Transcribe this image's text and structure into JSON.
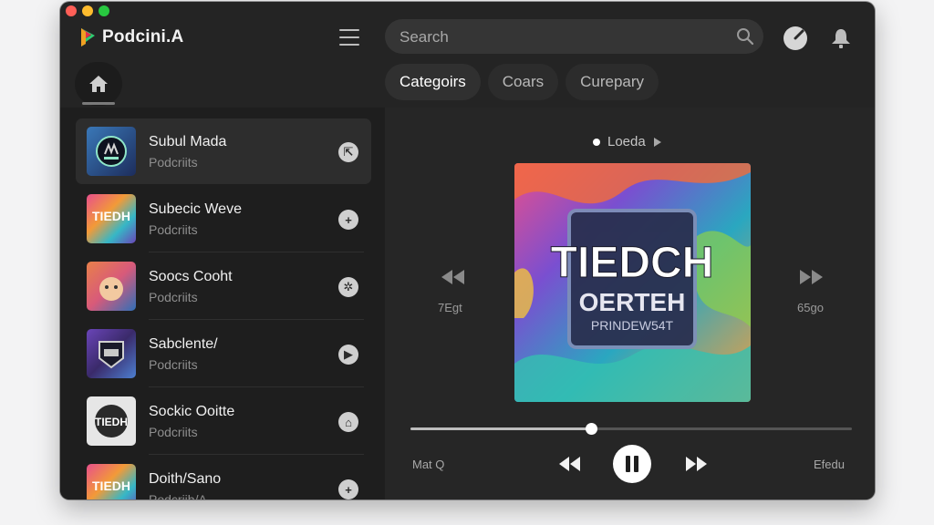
{
  "app": {
    "name": "Podcini.A"
  },
  "colors": {
    "window_bg": "#242424",
    "sidebar_bg": "#1e1e1e",
    "accent_green": "#2ecc71",
    "accent_red": "#e0304a"
  },
  "search": {
    "placeholder": "Search"
  },
  "tabs": [
    {
      "label": "Categoirs",
      "active": true
    },
    {
      "label": "Coars",
      "active": false
    },
    {
      "label": "Curepary",
      "active": false
    }
  ],
  "episodes": [
    {
      "title": "Subul Mada",
      "subtitle": "Podcriits",
      "action_icon": "share-icon",
      "selected": true
    },
    {
      "title": "Subecic Weve",
      "subtitle": "Podcriits",
      "action_icon": "plus-icon",
      "selected": false
    },
    {
      "title": "Soocs Cooht",
      "subtitle": "Podcriits",
      "action_icon": "settings-icon",
      "selected": false
    },
    {
      "title": "Sabclente/",
      "subtitle": "Podcriits",
      "action_icon": "play-icon",
      "selected": false
    },
    {
      "title": "Sockic Ooitte",
      "subtitle": "Podcriits",
      "action_icon": "home-icon",
      "selected": false
    },
    {
      "title": "Doith/Sano",
      "subtitle": "Podcriib/A",
      "action_icon": "plus-icon",
      "selected": false
    }
  ],
  "thumbs": [
    {
      "text": ""
    },
    {
      "text": "TIEDH"
    },
    {
      "text": ""
    },
    {
      "text": ""
    },
    {
      "text": "TIEDH"
    },
    {
      "text": "TIEDH"
    }
  ],
  "now_playing": {
    "status": "Loeda",
    "cover": {
      "line1": "TIEDCH",
      "line2": "OERTEH",
      "line3": "PRINDEW54T"
    },
    "left_label": "7Egt",
    "right_label": "65go",
    "progress": 0.41,
    "time_left": "Mat Q",
    "time_right": "Efedu"
  }
}
